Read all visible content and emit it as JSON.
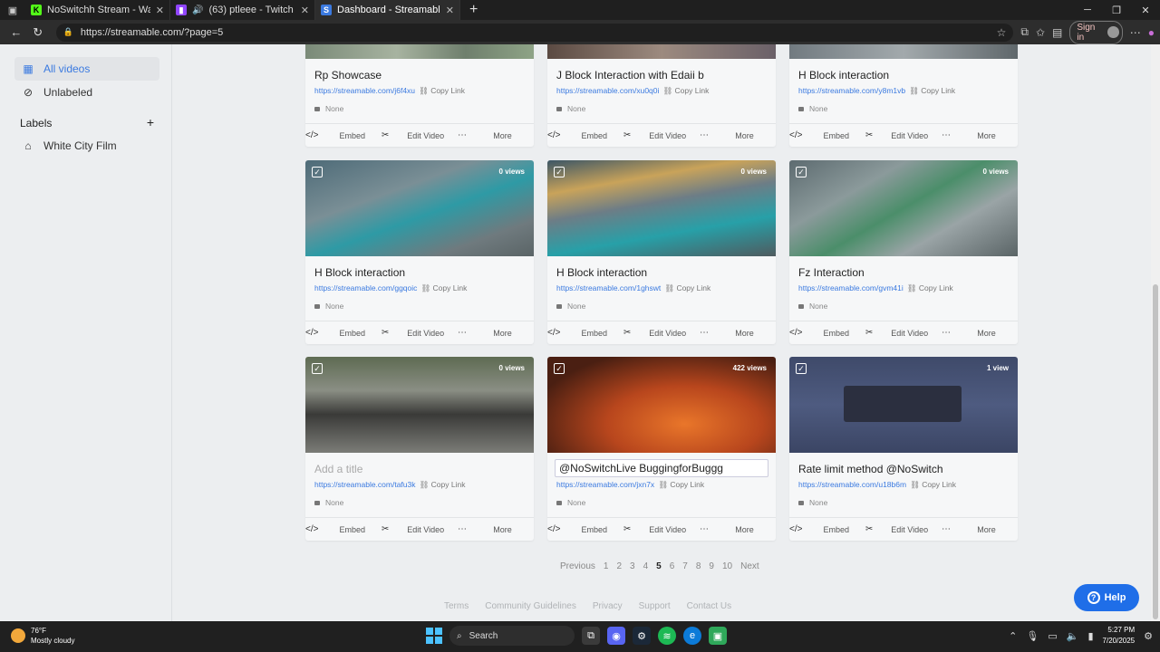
{
  "browser": {
    "tabs": [
      {
        "title": "NoSwitchh Stream - Watch Live o",
        "favicon": "kick-icon",
        "color": "#53fc18"
      },
      {
        "title": "(63) ptleee - Twitch",
        "favicon": "twitch-icon",
        "color": "#9146ff"
      },
      {
        "title": "Dashboard - Streamable",
        "favicon": "streamable-icon",
        "color": "#3b7ae0"
      }
    ],
    "url": "https://streamable.com/?page=5",
    "signin": "Sign in"
  },
  "sidebar": {
    "items": [
      {
        "label": "All videos",
        "icon": "grid-icon"
      },
      {
        "label": "Unlabeled",
        "icon": "unlabeled-icon"
      }
    ],
    "labels_heading": "Labels",
    "labels": [
      {
        "label": "White City Film",
        "icon": "tag-icon"
      }
    ]
  },
  "cards": [
    {
      "title": "Rp Showcase",
      "link": "https://streamable.com/j6f4xu",
      "views": "",
      "label": "None"
    },
    {
      "title": "J Block Interaction with Edaii b",
      "link": "https://streamable.com/xu0q0i",
      "views": "",
      "label": "None"
    },
    {
      "title": "H Block interaction",
      "link": "https://streamable.com/y8m1vb",
      "views": "",
      "label": "None"
    },
    {
      "title": "H Block interaction",
      "link": "https://streamable.com/ggqoic",
      "views": "0 views",
      "label": "None"
    },
    {
      "title": "H Block interaction",
      "link": "https://streamable.com/1ghswt",
      "views": "0 views",
      "label": "None"
    },
    {
      "title": "Fz Interaction",
      "link": "https://streamable.com/gvm41i",
      "views": "0 views",
      "label": "None"
    },
    {
      "title": "Add a title",
      "link": "https://streamable.com/tafu3k",
      "views": "0 views",
      "label": "None"
    },
    {
      "title": "@NoSwitchLive BuggingforBuggg",
      "link": "https://streamable.com/jxn7x",
      "views": "422 views",
      "label": "None"
    },
    {
      "title": "Rate limit method @NoSwitch",
      "link": "https://streamable.com/u18b6m",
      "views": "1 view",
      "label": "None"
    }
  ],
  "card_actions": {
    "copy": "Copy Link",
    "embed": "Embed",
    "edit": "Edit Video",
    "more": "More"
  },
  "pagination": {
    "prev": "Previous",
    "pages": [
      "1",
      "2",
      "3",
      "4",
      "5",
      "6",
      "7",
      "8",
      "9",
      "10"
    ],
    "current": "5",
    "next": "Next"
  },
  "footer": [
    "Terms",
    "Community Guidelines",
    "Privacy",
    "Support",
    "Contact Us"
  ],
  "help": "Help",
  "taskbar": {
    "temp": "76°F",
    "weather": "Mostly cloudy",
    "search": "Search",
    "time": "5:27 PM",
    "date": "7/20/2025"
  }
}
